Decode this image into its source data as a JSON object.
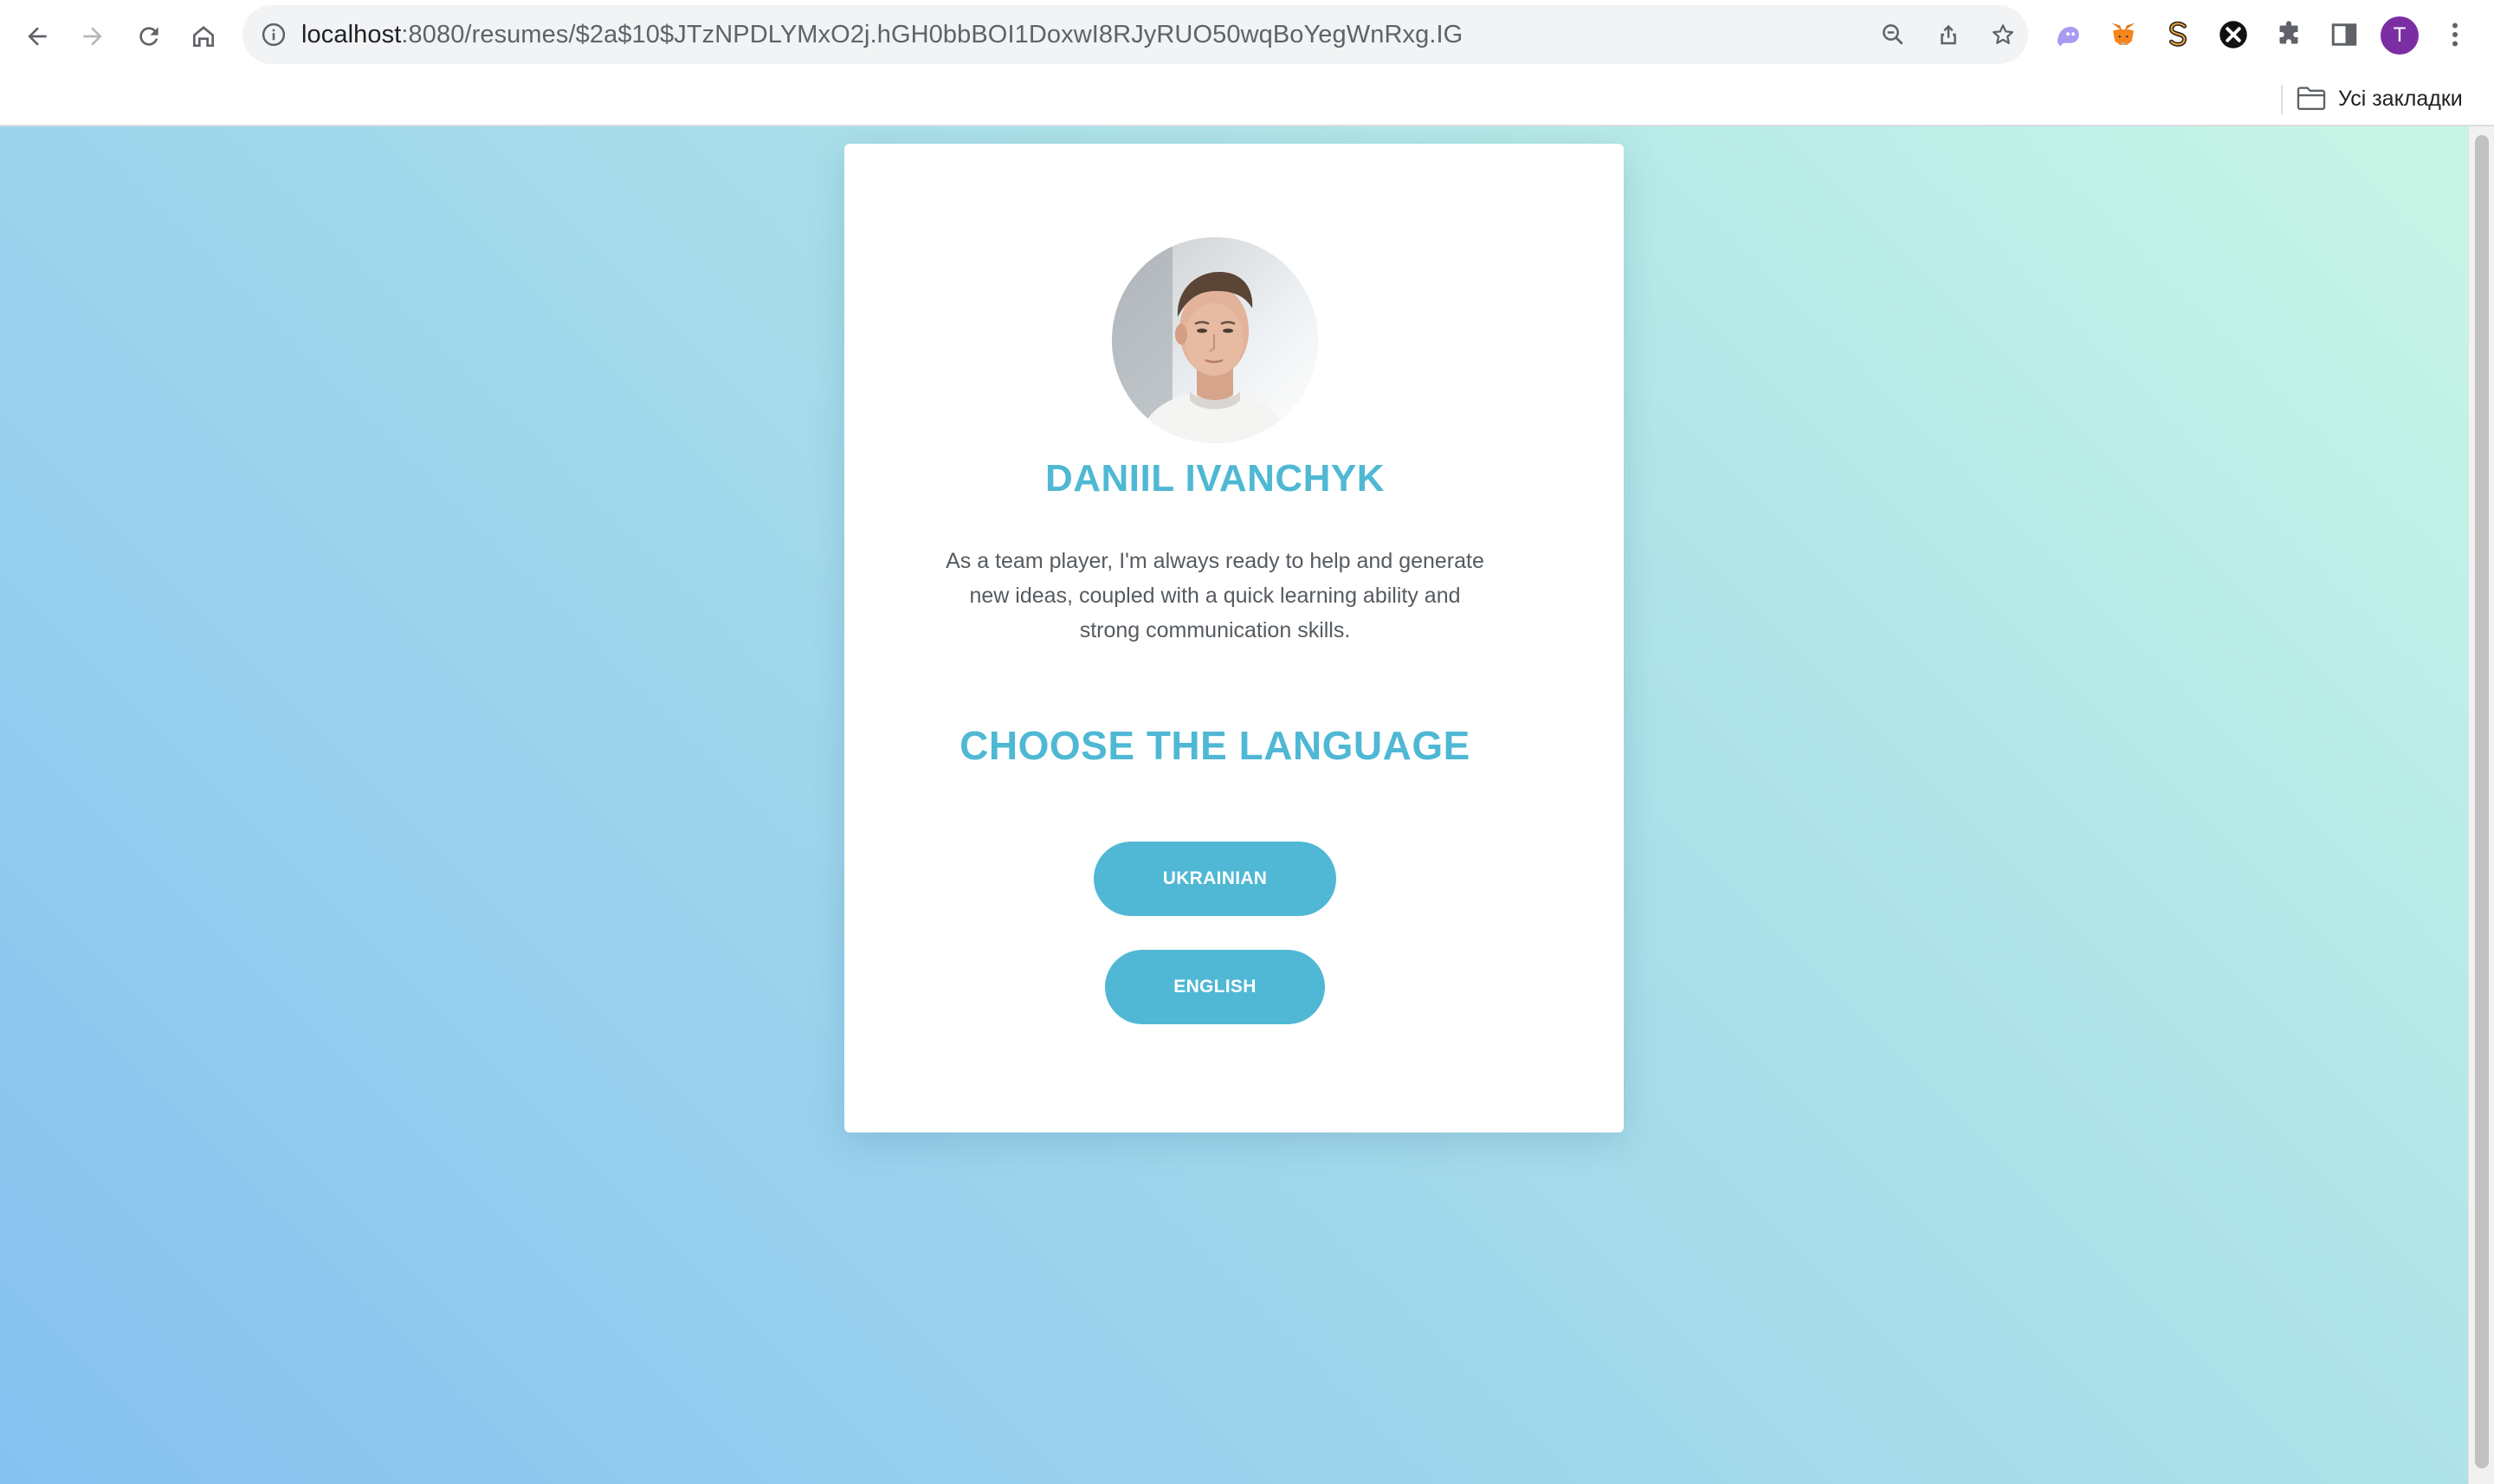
{
  "browser": {
    "url": {
      "host": "localhost",
      "path": ":8080/resumes/$2a$10$JTzNPDLYMxO2j.hGH0bbBOI1DoxwI8RJyRUO50wqBoYegWnRxg.IG"
    },
    "profile_initial": "T",
    "bookmarks_label": "Усі закладки"
  },
  "resume": {
    "name": "DANIIL IVANCHYK",
    "summary": "As a team player, I'm always ready to help and generate new ideas, coupled with a quick learning ability and strong communication skills.",
    "choose_heading": "CHOOSE THE LANGUAGE",
    "languages": [
      {
        "label": "UKRAINIAN"
      },
      {
        "label": "ENGLISH"
      }
    ]
  },
  "colors": {
    "accent": "#4fb8d4",
    "button": "#50b8d4",
    "profile": "#7b2ea4"
  }
}
